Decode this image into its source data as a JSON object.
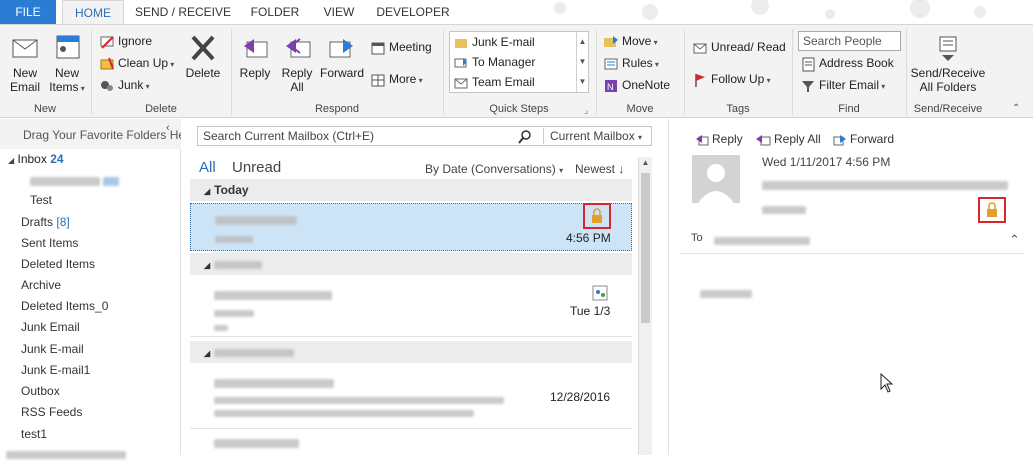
{
  "tabs": {
    "file": "FILE",
    "home": "HOME",
    "send_receive": "SEND / RECEIVE",
    "folder": "FOLDER",
    "view": "VIEW",
    "developer": "DEVELOPER"
  },
  "ribbon": {
    "new_email": [
      "New",
      "Email"
    ],
    "new_items": [
      "New",
      "Items"
    ],
    "group_new": "New",
    "ignore": "Ignore",
    "clean_up": "Clean Up",
    "junk": "Junk",
    "delete": "Delete",
    "group_delete": "Delete",
    "reply": "Reply",
    "reply_all": [
      "Reply",
      "All"
    ],
    "forward": "Forward",
    "meeting": "Meeting",
    "more": "More",
    "group_respond": "Respond",
    "qs_items": [
      "Junk E-mail",
      "To Manager",
      "Team Email"
    ],
    "group_quick_steps": "Quick Steps",
    "move": "Move",
    "rules": "Rules",
    "onenote": "OneNote",
    "group_move": "Move",
    "unread_read": "Unread/ Read",
    "follow_up": "Follow Up",
    "group_tags": "Tags",
    "search_people": "Search People",
    "address_book": "Address Book",
    "filter_email": "Filter Email",
    "group_find": "Find",
    "send_receive_all": [
      "Send/Receive",
      "All Folders"
    ],
    "group_send_receive": "Send/Receive"
  },
  "left": {
    "drag_text": "Drag Your Favorite Folders He",
    "inbox_label": "Inbox",
    "inbox_count": "24",
    "folders": [
      "Test",
      "Drafts",
      "Sent Items",
      "Deleted Items",
      "Archive",
      "Deleted Items_0",
      "Junk Email",
      "Junk E-mail",
      "Junk E-mail1",
      "Outbox",
      "RSS Feeds",
      "test1"
    ],
    "drafts_count": "[8]"
  },
  "mid": {
    "search_placeholder": "Search Current Mailbox (Ctrl+E)",
    "search_scope": "Current Mailbox",
    "filter_all": "All",
    "filter_unread": "Unread",
    "sort": "By Date (Conversations)",
    "order": "Newest",
    "group_today": "Today",
    "messages": [
      {
        "time": "4:56 PM"
      },
      {
        "time": "Tue 1/3"
      },
      {
        "time": "12/28/2016"
      }
    ]
  },
  "reading": {
    "reply": "Reply",
    "reply_all": "Reply All",
    "forward": "Forward",
    "date": "Wed 1/11/2017 4:56 PM",
    "to_label": "To"
  },
  "colors": {
    "accent": "#2b7cd3",
    "selected_row": "#cde4f7",
    "highlight_box": "#d9262c",
    "lock": "#e0a030"
  }
}
